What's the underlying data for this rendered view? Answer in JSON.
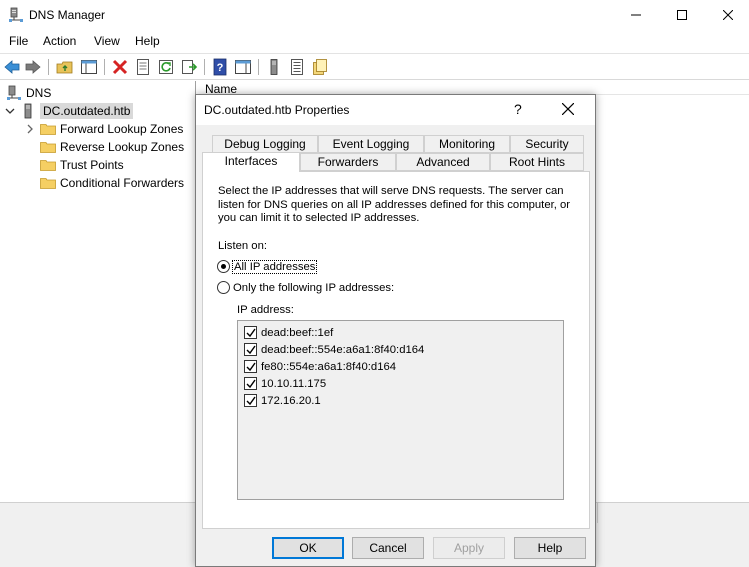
{
  "window": {
    "title": "DNS Manager"
  },
  "menu": [
    "File",
    "Action",
    "View",
    "Help"
  ],
  "tree": {
    "root": "DNS",
    "server": "DC.outdated.htb",
    "children": [
      "Forward Lookup Zones",
      "Reverse Lookup Zones",
      "Trust Points",
      "Conditional Forwarders"
    ]
  },
  "rightpane": {
    "column_name": "Name"
  },
  "dialog": {
    "title": "DC.outdated.htb Properties",
    "help_glyph": "?",
    "tabs_row1": [
      "Debug Logging",
      "Event Logging",
      "Monitoring",
      "Security"
    ],
    "tabs_row2": [
      "Interfaces",
      "Forwarders",
      "Advanced",
      "Root Hints"
    ],
    "active_tab": "Interfaces",
    "description": "Select the IP addresses that will serve DNS requests. The server can listen for DNS queries on all IP addresses defined for this computer, or you can limit it to selected IP addresses.",
    "listen_on_label": "Listen on:",
    "radio_all": "All IP addresses",
    "radio_only": "Only the following IP addresses:",
    "ip_address_label": "IP address:",
    "ip_addresses": [
      "dead:beef::1ef",
      "dead:beef::554e:a6a1:8f40:d164",
      "fe80::554e:a6a1:8f40:d164",
      "10.10.11.175",
      "172.16.20.1"
    ],
    "buttons": {
      "ok": "OK",
      "cancel": "Cancel",
      "apply": "Apply",
      "help": "Help"
    }
  }
}
